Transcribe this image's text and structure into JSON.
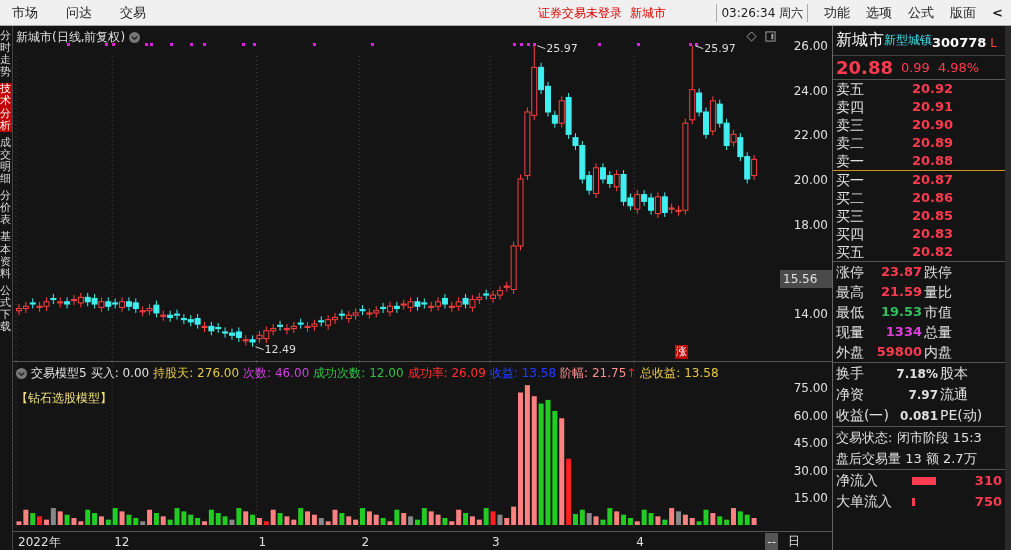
{
  "menu_bar": {
    "items": [
      "市场",
      "问达",
      "交易"
    ],
    "notice": "证券交易未登录",
    "stock_link": "新城市",
    "clock": "03:26:34 周六",
    "right_items": [
      "功能",
      "选项",
      "公式",
      "版面"
    ],
    "collapse": "<"
  },
  "side_tabs": [
    {
      "label": "分时走势",
      "selected": false
    },
    {
      "label": "技术分析",
      "selected": true
    },
    {
      "label": "成交明细",
      "selected": false
    },
    {
      "label": "分价表",
      "selected": false
    },
    {
      "label": "基本资料",
      "selected": false
    },
    {
      "label": "公式下载",
      "selected": false
    }
  ],
  "main_chart": {
    "title": "新城市(日线,前复权)",
    "high_labels": [
      "25.97",
      "25.97"
    ],
    "low_label": "12.49",
    "limit_badge": "涨"
  },
  "price_axis": {
    "ticks": [
      "26.00",
      "24.00",
      "22.00",
      "20.00",
      "18.00",
      "14.00"
    ],
    "current": "15.56"
  },
  "indicator": {
    "name": "交易模型5",
    "stats": [
      {
        "label": "买入:",
        "value": "0.00",
        "color": "#e0e0e0"
      },
      {
        "label": "持股天:",
        "value": "276.00",
        "color": "#e8c840"
      },
      {
        "label": "次数:",
        "value": "46.00",
        "color": "#d040e0"
      },
      {
        "label": "成功次数:",
        "value": "12.00",
        "color": "#30c040"
      },
      {
        "label": "成功率:",
        "value": "26.09",
        "color": "#ff3030"
      },
      {
        "label": "收益:",
        "value": "13.58",
        "color": "#2040ff"
      },
      {
        "label": "阶幅:",
        "value": "21.75",
        "color": "#ff9090",
        "suffix": "↑"
      },
      {
        "label": "总收益:",
        "value": "13.58",
        "color": "#e8c840"
      }
    ],
    "caption": "【钻石选股模型】"
  },
  "volume_axis": {
    "ticks": [
      "75.00",
      "60.00",
      "45.00",
      "30.00",
      "15.00"
    ]
  },
  "date_axis": {
    "labels": [
      "2022年",
      "12",
      "1",
      "2",
      "3",
      "4"
    ],
    "end_marker": "--",
    "period": "日"
  },
  "quote": {
    "name": "新城市",
    "sector": "新型城镇",
    "code": "300778",
    "market_flag": "L",
    "price": "20.88",
    "change": "0.99",
    "change_pct": "4.98%",
    "asks": [
      {
        "label": "卖五",
        "price": "20.92"
      },
      {
        "label": "卖四",
        "price": "20.91"
      },
      {
        "label": "卖三",
        "price": "20.90"
      },
      {
        "label": "卖二",
        "price": "20.89"
      },
      {
        "label": "卖一",
        "price": "20.88"
      }
    ],
    "bids": [
      {
        "label": "买一",
        "price": "20.87"
      },
      {
        "label": "买二",
        "price": "20.86"
      },
      {
        "label": "买三",
        "price": "20.85"
      },
      {
        "label": "买四",
        "price": "20.83"
      },
      {
        "label": "买五",
        "price": "20.82"
      }
    ],
    "stats": [
      {
        "label": "涨停",
        "value": "23.87",
        "color": "#ff3b50",
        "label2": "跌停"
      },
      {
        "label": "最高",
        "value": "21.59",
        "color": "#ff3b50",
        "label2": "量比"
      },
      {
        "label": "最低",
        "value": "19.53",
        "color": "#30c060",
        "label2": "市值"
      },
      {
        "label": "现量",
        "value": "1334",
        "color": "#e040e0",
        "label2": "总量"
      },
      {
        "label": "外盘",
        "value": "59800",
        "color": "#ff3b50",
        "label2": "内盘"
      }
    ],
    "fundamentals": [
      {
        "label": "换手",
        "value": "7.18%",
        "label2": "股本"
      },
      {
        "label": "净资",
        "value": "7.97",
        "label2": "流通"
      },
      {
        "label": "收益(一)",
        "value": "0.081",
        "label2": "PE(动)"
      }
    ],
    "trade_status": [
      "交易状态: 闭市阶段 15:3",
      "盘后交易量 13 额 2.7万"
    ],
    "flows": [
      {
        "label": "净流入",
        "value": "310"
      },
      {
        "label": "大单流入",
        "value": "750"
      }
    ]
  }
}
